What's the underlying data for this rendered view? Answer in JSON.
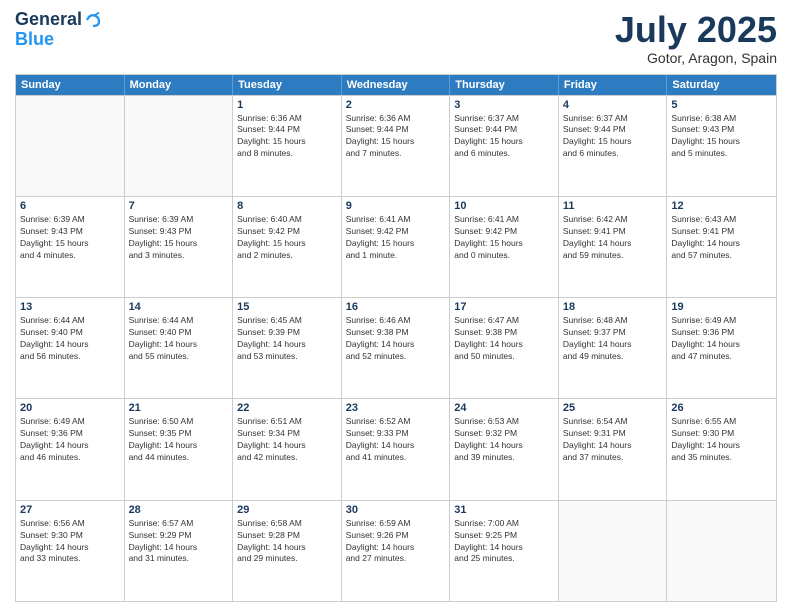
{
  "header": {
    "logo_line1": "General",
    "logo_line2": "Blue",
    "month": "July 2025",
    "location": "Gotor, Aragon, Spain"
  },
  "weekdays": [
    "Sunday",
    "Monday",
    "Tuesday",
    "Wednesday",
    "Thursday",
    "Friday",
    "Saturday"
  ],
  "weeks": [
    [
      {
        "day": "",
        "info": ""
      },
      {
        "day": "",
        "info": ""
      },
      {
        "day": "1",
        "info": "Sunrise: 6:36 AM\nSunset: 9:44 PM\nDaylight: 15 hours\nand 8 minutes."
      },
      {
        "day": "2",
        "info": "Sunrise: 6:36 AM\nSunset: 9:44 PM\nDaylight: 15 hours\nand 7 minutes."
      },
      {
        "day": "3",
        "info": "Sunrise: 6:37 AM\nSunset: 9:44 PM\nDaylight: 15 hours\nand 6 minutes."
      },
      {
        "day": "4",
        "info": "Sunrise: 6:37 AM\nSunset: 9:44 PM\nDaylight: 15 hours\nand 6 minutes."
      },
      {
        "day": "5",
        "info": "Sunrise: 6:38 AM\nSunset: 9:43 PM\nDaylight: 15 hours\nand 5 minutes."
      }
    ],
    [
      {
        "day": "6",
        "info": "Sunrise: 6:39 AM\nSunset: 9:43 PM\nDaylight: 15 hours\nand 4 minutes."
      },
      {
        "day": "7",
        "info": "Sunrise: 6:39 AM\nSunset: 9:43 PM\nDaylight: 15 hours\nand 3 minutes."
      },
      {
        "day": "8",
        "info": "Sunrise: 6:40 AM\nSunset: 9:42 PM\nDaylight: 15 hours\nand 2 minutes."
      },
      {
        "day": "9",
        "info": "Sunrise: 6:41 AM\nSunset: 9:42 PM\nDaylight: 15 hours\nand 1 minute."
      },
      {
        "day": "10",
        "info": "Sunrise: 6:41 AM\nSunset: 9:42 PM\nDaylight: 15 hours\nand 0 minutes."
      },
      {
        "day": "11",
        "info": "Sunrise: 6:42 AM\nSunset: 9:41 PM\nDaylight: 14 hours\nand 59 minutes."
      },
      {
        "day": "12",
        "info": "Sunrise: 6:43 AM\nSunset: 9:41 PM\nDaylight: 14 hours\nand 57 minutes."
      }
    ],
    [
      {
        "day": "13",
        "info": "Sunrise: 6:44 AM\nSunset: 9:40 PM\nDaylight: 14 hours\nand 56 minutes."
      },
      {
        "day": "14",
        "info": "Sunrise: 6:44 AM\nSunset: 9:40 PM\nDaylight: 14 hours\nand 55 minutes."
      },
      {
        "day": "15",
        "info": "Sunrise: 6:45 AM\nSunset: 9:39 PM\nDaylight: 14 hours\nand 53 minutes."
      },
      {
        "day": "16",
        "info": "Sunrise: 6:46 AM\nSunset: 9:38 PM\nDaylight: 14 hours\nand 52 minutes."
      },
      {
        "day": "17",
        "info": "Sunrise: 6:47 AM\nSunset: 9:38 PM\nDaylight: 14 hours\nand 50 minutes."
      },
      {
        "day": "18",
        "info": "Sunrise: 6:48 AM\nSunset: 9:37 PM\nDaylight: 14 hours\nand 49 minutes."
      },
      {
        "day": "19",
        "info": "Sunrise: 6:49 AM\nSunset: 9:36 PM\nDaylight: 14 hours\nand 47 minutes."
      }
    ],
    [
      {
        "day": "20",
        "info": "Sunrise: 6:49 AM\nSunset: 9:36 PM\nDaylight: 14 hours\nand 46 minutes."
      },
      {
        "day": "21",
        "info": "Sunrise: 6:50 AM\nSunset: 9:35 PM\nDaylight: 14 hours\nand 44 minutes."
      },
      {
        "day": "22",
        "info": "Sunrise: 6:51 AM\nSunset: 9:34 PM\nDaylight: 14 hours\nand 42 minutes."
      },
      {
        "day": "23",
        "info": "Sunrise: 6:52 AM\nSunset: 9:33 PM\nDaylight: 14 hours\nand 41 minutes."
      },
      {
        "day": "24",
        "info": "Sunrise: 6:53 AM\nSunset: 9:32 PM\nDaylight: 14 hours\nand 39 minutes."
      },
      {
        "day": "25",
        "info": "Sunrise: 6:54 AM\nSunset: 9:31 PM\nDaylight: 14 hours\nand 37 minutes."
      },
      {
        "day": "26",
        "info": "Sunrise: 6:55 AM\nSunset: 9:30 PM\nDaylight: 14 hours\nand 35 minutes."
      }
    ],
    [
      {
        "day": "27",
        "info": "Sunrise: 6:56 AM\nSunset: 9:30 PM\nDaylight: 14 hours\nand 33 minutes."
      },
      {
        "day": "28",
        "info": "Sunrise: 6:57 AM\nSunset: 9:29 PM\nDaylight: 14 hours\nand 31 minutes."
      },
      {
        "day": "29",
        "info": "Sunrise: 6:58 AM\nSunset: 9:28 PM\nDaylight: 14 hours\nand 29 minutes."
      },
      {
        "day": "30",
        "info": "Sunrise: 6:59 AM\nSunset: 9:26 PM\nDaylight: 14 hours\nand 27 minutes."
      },
      {
        "day": "31",
        "info": "Sunrise: 7:00 AM\nSunset: 9:25 PM\nDaylight: 14 hours\nand 25 minutes."
      },
      {
        "day": "",
        "info": ""
      },
      {
        "day": "",
        "info": ""
      }
    ]
  ]
}
